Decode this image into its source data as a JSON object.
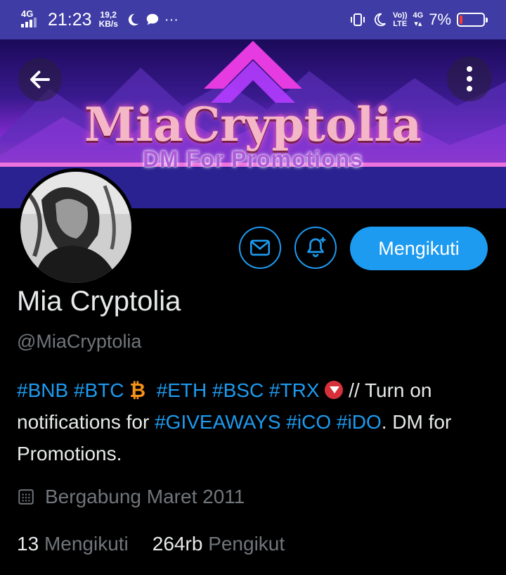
{
  "status_bar": {
    "network": "4G",
    "time": "21:23",
    "speed_value": "19,2",
    "speed_unit": "KB/s",
    "more": "···",
    "volte_top": "Vo))",
    "volte_bottom": "LTE",
    "net2_top": "4G",
    "net2_bottom": "▾▴",
    "battery_percent": "7%",
    "battery_level": 0.07
  },
  "banner": {
    "title": "MiaCryptolia",
    "subtitle": "DM For Promotions"
  },
  "icons": {
    "back": "arrow-left-icon",
    "more": "more-vertical-icon",
    "mail": "mail-icon",
    "bell": "bell-plus-icon",
    "calendar": "calendar-icon"
  },
  "actions": {
    "follow_label": "Mengikuti"
  },
  "profile": {
    "name": "Mia Cryptolia",
    "handle": "@MiaCryptolia",
    "bio": {
      "t1": "#BNB",
      "t2": "#BTC",
      "btc_emoji": "₿",
      "t3": "#ETH",
      "t4": "#BSC",
      "t5": "#TRX",
      "text1": " // Turn on notifications for ",
      "t6": "#GIVEAWAYS",
      "t7": "#iCO",
      "t8": "#iDO",
      "text2": ". DM for Promotions."
    },
    "joined": "Bergabung Maret 2011",
    "following_count": "13",
    "following_label": "Mengikuti",
    "followers_count": "264rb",
    "followers_label": "Pengikut"
  },
  "colors": {
    "accent": "#1d9bf0",
    "status_bar": "#3f3ca6",
    "muted": "#71767b"
  }
}
